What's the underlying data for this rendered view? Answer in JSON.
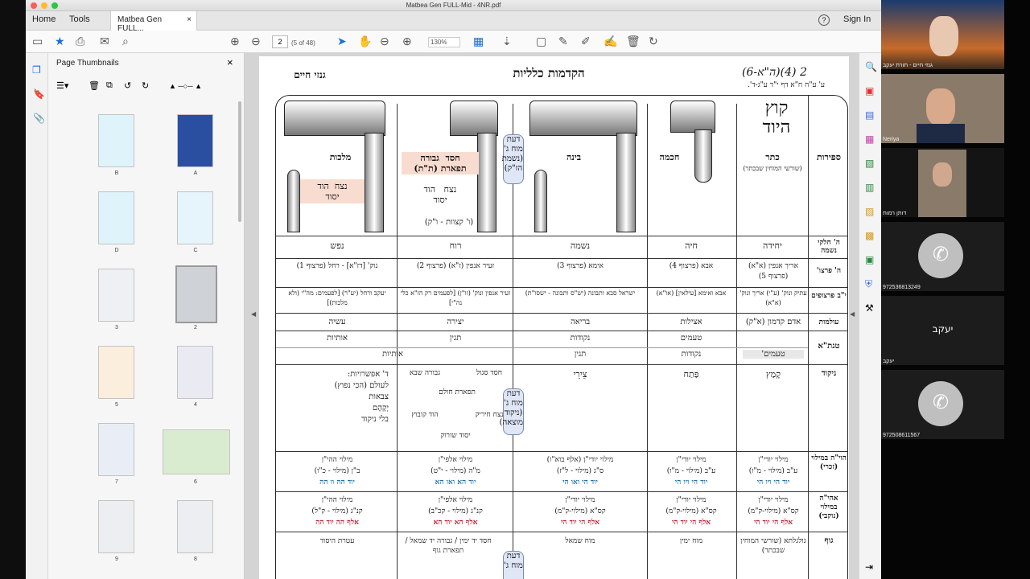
{
  "window": {
    "title": "Matbea Gen FULL-Mid - 4NR.pdf"
  },
  "menu": {
    "home": "Home",
    "tools": "Tools",
    "tab": "Matbea Gen FULL...",
    "signin": "Sign In",
    "help": "?"
  },
  "toolbar": {
    "page": "2",
    "page_of": "(5 of 48)",
    "zoom": "130%"
  },
  "thumbs": {
    "title": "Page Thumbnails",
    "labels": [
      "B",
      "A",
      "D",
      "C",
      "3",
      "2",
      "5",
      "4",
      "7",
      "6",
      "9",
      "8"
    ]
  },
  "doc": {
    "header_num": "2",
    "header_ref": "(ה\"א-6)(4)",
    "header_sub": "ע' ע\"ח ח\"א דף י\"ד ע\"ג-ד'.",
    "title": "הקדמות כלליות",
    "topright": "גנזי חיים",
    "kotz": "קוץ היוד",
    "sefirot_hdr": "ספירות",
    "col_keter": "כתר",
    "col_keter_sub": "(שורשי המוחין שבכתר)",
    "col_chochma": "חכמה",
    "col_bina": "בינה",
    "daat1": "דעת מוח ג' (נשמת הז\"ק)",
    "col_zeir": [
      "חסד",
      "גבורה",
      "תפארת (ת\"ת)",
      "נצח",
      "הוד",
      "יסוד"
    ],
    "col_zeir_note": "(ו' קצוות - ו\"ק)",
    "col_malchut": "מלכות",
    "col_malchut_sub": [
      "נצח",
      "הוד",
      "יסוד"
    ],
    "r1_label": "ה' חלקי נשמה",
    "r1": [
      "יחידה",
      "חיה",
      "נשמה",
      "רוח",
      "נפש"
    ],
    "r2_label": "ה' פרצו'",
    "r2": [
      "אריך אנפין (א\"א) (פרצוף 5)",
      "אבא (פרצוף 4)",
      "אימא (פרצוף 3)",
      "זעיר אנפין (ז\"א) (פרצוף 2)",
      "נוק' [דז\"א] - רחל (פרצוף 1)"
    ],
    "r3_label": "י\"ב פרצופים",
    "r3": [
      "עתיק ונוק' (ע\"י) אריך ונוק' (א\"א)",
      "אבא ואימא [עילאין] (או\"א)",
      "ישראל סבא ותבונה (יש\"ס ותבונה - ישסו\"ת)",
      "זעיר אנפין ונוק' (זו\"ן) [לפעמים רק הז\"א כלי נה\"י]",
      "יעקב ורחל (יע\"ר) [לפעמים: מה\"י (ולא מלכות)]"
    ],
    "r4_label": "עולמות",
    "r4": [
      "אדם קדמון (א\"ק)",
      "אצילות",
      "בריאה",
      "יצירה",
      "עשיה"
    ],
    "r5_label": "טנת\"א",
    "r5a": [
      "טעמים",
      "נקודות",
      "תגין",
      "אותיות"
    ],
    "r5b": [
      "טעמים'",
      "נקודות",
      "תגין",
      "אותיות"
    ],
    "r6_label": "ניקוד",
    "r6": [
      "קָמַץ",
      "פַּתַח",
      "צֵירֵי"
    ],
    "r6_zeir": [
      "חסד סגול",
      "גבורה שבא",
      "תפארת חולם",
      "נצח חיריק",
      "הוד קובוץ",
      "יסוד שורוק"
    ],
    "r6_mal": [
      "ד' אפשרויות:",
      "לעולם (הכי נפוץ)",
      "צבאות",
      "יְקָהֶם",
      "בלי ניקוד"
    ],
    "daat2": "דעת מוח ג' (ניקוד מוצאה)",
    "r7_label": "הוי\"ה במילוי (זכרי)",
    "r7": [
      [
        "מילוי יודי\"ן",
        "ע\"ב (מילוי - מ\"ו)",
        "יוד הי ויו הי"
      ],
      [
        "מילוי יודי\"ן",
        "ע\"ב (מילוי - מ\"ו)",
        "יוד הי ויו הי"
      ],
      [
        "מילוי יודי\"ן (אלף בוא\"ו)",
        "ס\"ג (מילוי - ל\"ז)",
        "יוד הי ואו הי"
      ],
      [
        "מילוי אלפי\"ן",
        "מ\"ה (מילוי - י\"ט)",
        "יוד הא ואו הא"
      ],
      [
        "מילוי ההי\"ן",
        "ב\"ן (מילוי - כ\"ו)",
        "יוד הה וו הה"
      ]
    ],
    "r8_label": "אהי\"ה במילוי (נוקבי)",
    "r8": [
      [
        "מילוי יודי\"ן",
        "קס\"א (מילוי-ק\"מ)",
        "אלף הי יוד הי"
      ],
      [
        "מילוי יודי\"ן",
        "קס\"א (מילוי-ק\"מ)",
        "אלף הי יוד הי"
      ],
      [
        "מילוי יודי\"ן",
        "קס\"א (מילוי-ק\"מ)",
        "אלף הי יוד הי"
      ],
      [
        "מילוי אלפי\"ן",
        "קנ\"ג (מילוי - קכ\"ב)",
        "אלף הא יוד הא"
      ],
      [
        "מילוי ההי\"ן",
        "קנ\"ג (מילוי - ק\"ל)",
        "אלף הה יוד הה"
      ]
    ],
    "r9_label": "גוף",
    "r9": [
      "גולגלתא (שורשי המוחין שבכתר)",
      "מוח ימין",
      "מוח שמאל",
      "חסד יד ימין / גבורה יד שמאל / תפארת גוף",
      "עטרת היסוד"
    ],
    "daat3": "דעת מוח ג'"
  },
  "video": {
    "tiles": [
      "גנזי חיים - תורת יעקב",
      "Neriya",
      "דותן רמות",
      "972536813249",
      "יעקב",
      "יעקב",
      "972508611567"
    ]
  }
}
